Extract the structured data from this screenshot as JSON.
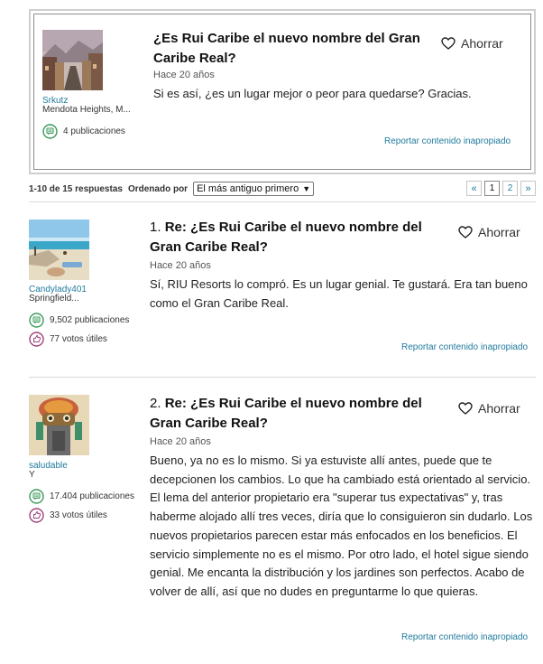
{
  "topic": {
    "author": "Srkutz",
    "location": "Mendota Heights, M...",
    "posts": "4 publicaciones",
    "title": "¿Es Rui Caribe el nuevo nombre del Gran Caribe Real?",
    "ago": "Hace 20 años",
    "body": "Si es así, ¿es un lugar mejor o peor para quedarse? Gracias.",
    "save_label": "Ahorrar",
    "report_label": "Reportar contenido inapropiado"
  },
  "pager": {
    "summary": "1-10 de 15 respuestas",
    "sort_label": "Ordenado por",
    "sort_value": "El más antiguo primero",
    "prev": "«",
    "pages": [
      "1",
      "2"
    ],
    "next": "»"
  },
  "replies": [
    {
      "number": "1.",
      "author": "Candylady401",
      "location": "Springfield...",
      "posts": "9,502 publicaciones",
      "votes": "77 votos útiles",
      "title": "Re: ¿Es Rui Caribe el nuevo nombre del Gran Caribe Real?",
      "ago": "Hace 20 años",
      "body": "Sí, RIU Resorts lo compró. Es un lugar genial. Te gustará. Era tan bueno como el Gran Caribe Real.",
      "save_label": "Ahorrar",
      "report_label": "Reportar contenido inapropiado"
    },
    {
      "number": "2.",
      "author": "saludable",
      "location": "Y",
      "posts": "17.404 publicaciones",
      "votes": "33 votos útiles",
      "title": "Re: ¿Es Rui Caribe el nuevo nombre del Gran Caribe Real?",
      "ago": "Hace 20 años",
      "body": "Bueno, ya no es lo mismo. Si ya estuviste allí antes, puede que te decepcionen los cambios. Lo que ha cambiado está orientado al servicio. El lema del anterior propietario era \"superar tus expectativas\" y, tras haberme alojado allí tres veces, diría que lo consiguieron sin dudarlo. Los nuevos propietarios parecen estar más enfocados en los beneficios. El servicio simplemente no es el mismo. Por otro lado, el hotel sigue siendo genial. Me encanta la distribución y los jardines son perfectos. Acabo de volver de allí, así que no dudes en preguntarme lo que quieras.",
      "save_label": "Ahorrar",
      "report_label": "Reportar contenido inapropiado"
    }
  ]
}
